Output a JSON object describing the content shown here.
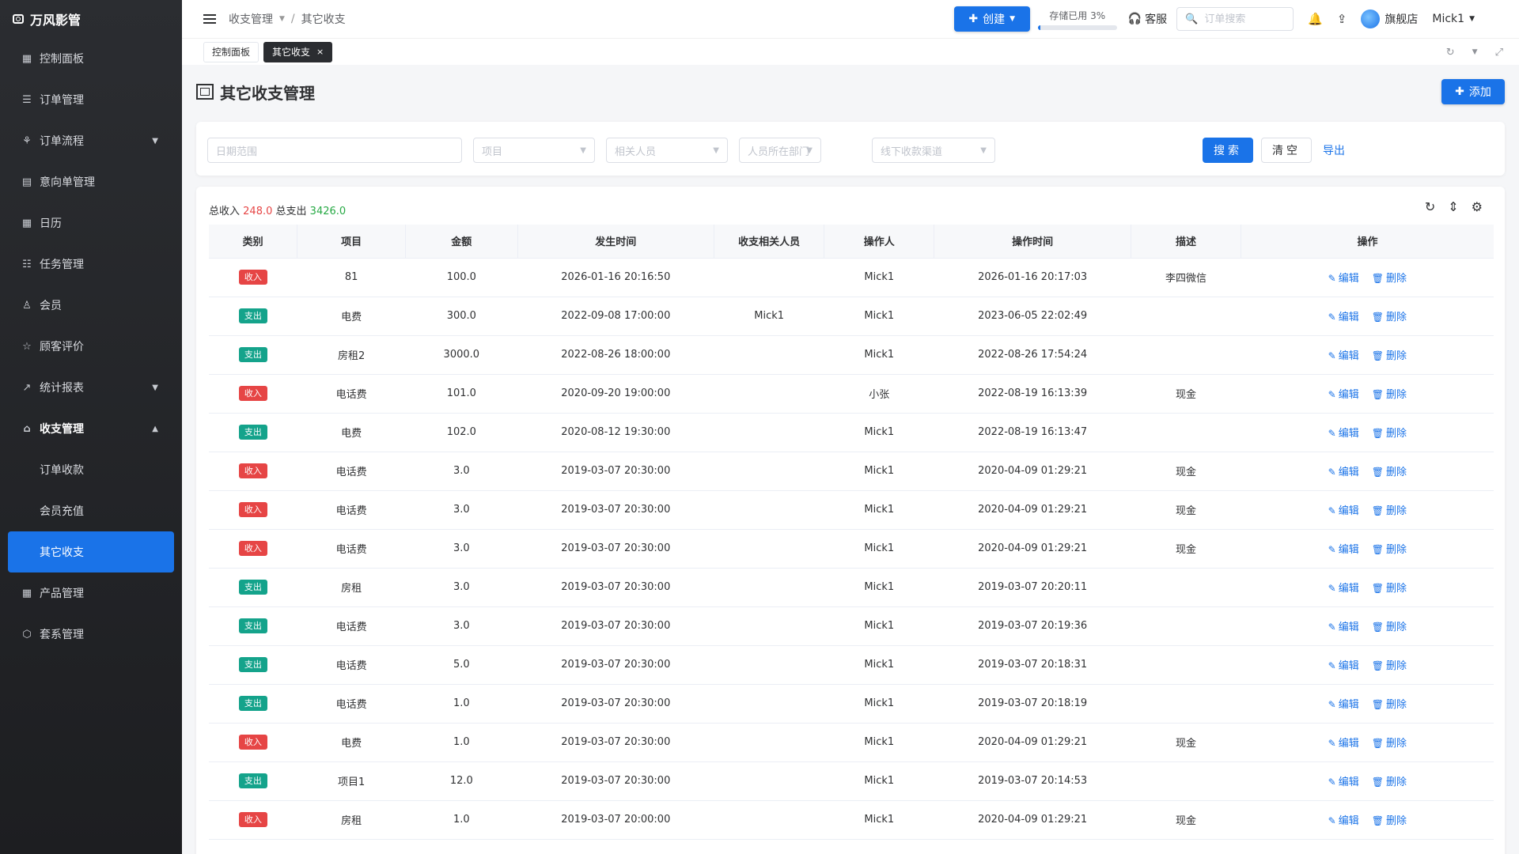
{
  "app": {
    "brand": "万风影管"
  },
  "sidebar": {
    "items": [
      {
        "label": "控制面板",
        "icon": "grid-icon"
      },
      {
        "label": "订单管理",
        "icon": "list-icon"
      },
      {
        "label": "订单流程",
        "icon": "flow-icon",
        "expandable": true
      },
      {
        "label": "意向单管理",
        "icon": "clipboard-icon"
      },
      {
        "label": "日历",
        "icon": "calendar-icon"
      },
      {
        "label": "任务管理",
        "icon": "tasks-icon"
      },
      {
        "label": "会员",
        "icon": "user-icon"
      },
      {
        "label": "顾客评价",
        "icon": "star-icon"
      },
      {
        "label": "统计报表",
        "icon": "chart-icon",
        "expandable": true
      },
      {
        "label": "收支管理",
        "icon": "bank-icon",
        "expanded": true
      },
      {
        "label": "订单收款",
        "sub": true
      },
      {
        "label": "会员充值",
        "sub": true
      },
      {
        "label": "其它收支",
        "sub": true,
        "active": true
      },
      {
        "label": "产品管理",
        "icon": "product-icon"
      },
      {
        "label": "套系管理",
        "icon": "package-icon"
      }
    ]
  },
  "header": {
    "breadcrumb": [
      "收支管理",
      "其它收支"
    ],
    "create_label": "创建",
    "storage_label": "存储已用 3%",
    "storage_percent": 3,
    "service_label": "客服",
    "search_placeholder": "订单搜索",
    "store_label": "旗舰店",
    "user_name": "Mick1"
  },
  "tabs": [
    {
      "label": "控制面板",
      "active": false
    },
    {
      "label": "其它收支",
      "active": true
    }
  ],
  "page": {
    "title": "其它收支管理",
    "add_label": "添加"
  },
  "filters": {
    "date_range": "日期范围",
    "project": "项目",
    "person": "相关人员",
    "department": "人员所在部门",
    "channel": "线下收款渠道",
    "search_label": "搜索",
    "clear_label": "清空",
    "export_label": "导出"
  },
  "summary": {
    "income_label": "总收入",
    "income_value": "248.0",
    "expense_label": "总支出",
    "expense_value": "3426.0"
  },
  "table": {
    "columns": [
      "类别",
      "项目",
      "金额",
      "发生时间",
      "收支相关人员",
      "操作人",
      "操作时间",
      "描述",
      "操作"
    ],
    "edit_label": "编辑",
    "delete_label": "删除",
    "rows": [
      {
        "type": "收入",
        "kind": "in",
        "project": "81",
        "amount": "100.0",
        "time": "2026-01-16 20:16:50",
        "person": "",
        "operator": "Mick1",
        "op_time": "2026-01-16 20:17:03",
        "desc": "李四微信"
      },
      {
        "type": "支出",
        "kind": "out",
        "project": "电费",
        "amount": "300.0",
        "time": "2022-09-08 17:00:00",
        "person": "Mick1",
        "operator": "Mick1",
        "op_time": "2023-06-05 22:02:49",
        "desc": ""
      },
      {
        "type": "支出",
        "kind": "out",
        "project": "房租2",
        "amount": "3000.0",
        "time": "2022-08-26 18:00:00",
        "person": "",
        "operator": "Mick1",
        "op_time": "2022-08-26 17:54:24",
        "desc": ""
      },
      {
        "type": "收入",
        "kind": "in",
        "project": "电话费",
        "amount": "101.0",
        "time": "2020-09-20 19:00:00",
        "person": "",
        "operator": "小张",
        "op_time": "2022-08-19 16:13:39",
        "desc": "现金"
      },
      {
        "type": "支出",
        "kind": "out",
        "project": "电费",
        "amount": "102.0",
        "time": "2020-08-12 19:30:00",
        "person": "",
        "operator": "Mick1",
        "op_time": "2022-08-19 16:13:47",
        "desc": ""
      },
      {
        "type": "收入",
        "kind": "in",
        "project": "电话费",
        "amount": "3.0",
        "time": "2019-03-07 20:30:00",
        "person": "",
        "operator": "Mick1",
        "op_time": "2020-04-09 01:29:21",
        "desc": "现金"
      },
      {
        "type": "收入",
        "kind": "in",
        "project": "电话费",
        "amount": "3.0",
        "time": "2019-03-07 20:30:00",
        "person": "",
        "operator": "Mick1",
        "op_time": "2020-04-09 01:29:21",
        "desc": "现金"
      },
      {
        "type": "收入",
        "kind": "in",
        "project": "电话费",
        "amount": "3.0",
        "time": "2019-03-07 20:30:00",
        "person": "",
        "operator": "Mick1",
        "op_time": "2020-04-09 01:29:21",
        "desc": "现金"
      },
      {
        "type": "支出",
        "kind": "out",
        "project": "房租",
        "amount": "3.0",
        "time": "2019-03-07 20:30:00",
        "person": "",
        "operator": "Mick1",
        "op_time": "2019-03-07 20:20:11",
        "desc": ""
      },
      {
        "type": "支出",
        "kind": "out",
        "project": "电话费",
        "amount": "3.0",
        "time": "2019-03-07 20:30:00",
        "person": "",
        "operator": "Mick1",
        "op_time": "2019-03-07 20:19:36",
        "desc": ""
      },
      {
        "type": "支出",
        "kind": "out",
        "project": "电话费",
        "amount": "5.0",
        "time": "2019-03-07 20:30:00",
        "person": "",
        "operator": "Mick1",
        "op_time": "2019-03-07 20:18:31",
        "desc": ""
      },
      {
        "type": "支出",
        "kind": "out",
        "project": "电话费",
        "amount": "1.0",
        "time": "2019-03-07 20:30:00",
        "person": "",
        "operator": "Mick1",
        "op_time": "2019-03-07 20:18:19",
        "desc": ""
      },
      {
        "type": "收入",
        "kind": "in",
        "project": "电费",
        "amount": "1.0",
        "time": "2019-03-07 20:30:00",
        "person": "",
        "operator": "Mick1",
        "op_time": "2020-04-09 01:29:21",
        "desc": "现金"
      },
      {
        "type": "支出",
        "kind": "out",
        "project": "项目1",
        "amount": "12.0",
        "time": "2019-03-07 20:30:00",
        "person": "",
        "operator": "Mick1",
        "op_time": "2019-03-07 20:14:53",
        "desc": ""
      },
      {
        "type": "收入",
        "kind": "in",
        "project": "房租",
        "amount": "1.0",
        "time": "2019-03-07 20:00:00",
        "person": "",
        "operator": "Mick1",
        "op_time": "2020-04-09 01:29:21",
        "desc": "现金"
      }
    ]
  },
  "colors": {
    "primary": "#1a73e8",
    "income_tag": "#e64545",
    "expense_tag": "#14a38b",
    "income_text": "#e64545",
    "expense_text": "#26a944",
    "sidebar_bg": "#2b2d31"
  }
}
